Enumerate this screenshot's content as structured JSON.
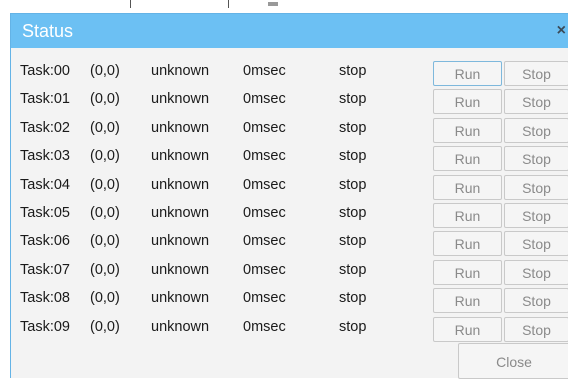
{
  "dialog": {
    "title": "Status",
    "close_icon": "×",
    "close_label": "Close",
    "colors": {
      "titlebar": "#6cc0f3",
      "title_text": "#ffffff",
      "body": "#f3f3f3"
    }
  },
  "tasks": [
    {
      "name": "Task:00",
      "position": "(0,0)",
      "state": "unknown",
      "time": "0msec",
      "status": "stop",
      "run_label": "Run",
      "stop_label": "Stop"
    },
    {
      "name": "Task:01",
      "position": "(0,0)",
      "state": "unknown",
      "time": "0msec",
      "status": "stop",
      "run_label": "Run",
      "stop_label": "Stop"
    },
    {
      "name": "Task:02",
      "position": "(0,0)",
      "state": "unknown",
      "time": "0msec",
      "status": "stop",
      "run_label": "Run",
      "stop_label": "Stop"
    },
    {
      "name": "Task:03",
      "position": "(0,0)",
      "state": "unknown",
      "time": "0msec",
      "status": "stop",
      "run_label": "Run",
      "stop_label": "Stop"
    },
    {
      "name": "Task:04",
      "position": "(0,0)",
      "state": "unknown",
      "time": "0msec",
      "status": "stop",
      "run_label": "Run",
      "stop_label": "Stop"
    },
    {
      "name": "Task:05",
      "position": "(0,0)",
      "state": "unknown",
      "time": "0msec",
      "status": "stop",
      "run_label": "Run",
      "stop_label": "Stop"
    },
    {
      "name": "Task:06",
      "position": "(0,0)",
      "state": "unknown",
      "time": "0msec",
      "status": "stop",
      "run_label": "Run",
      "stop_label": "Stop"
    },
    {
      "name": "Task:07",
      "position": "(0,0)",
      "state": "unknown",
      "time": "0msec",
      "status": "stop",
      "run_label": "Run",
      "stop_label": "Stop"
    },
    {
      "name": "Task:08",
      "position": "(0,0)",
      "state": "unknown",
      "time": "0msec",
      "status": "stop",
      "run_label": "Run",
      "stop_label": "Stop"
    },
    {
      "name": "Task:09",
      "position": "(0,0)",
      "state": "unknown",
      "time": "0msec",
      "status": "stop",
      "run_label": "Run",
      "stop_label": "Stop"
    }
  ]
}
